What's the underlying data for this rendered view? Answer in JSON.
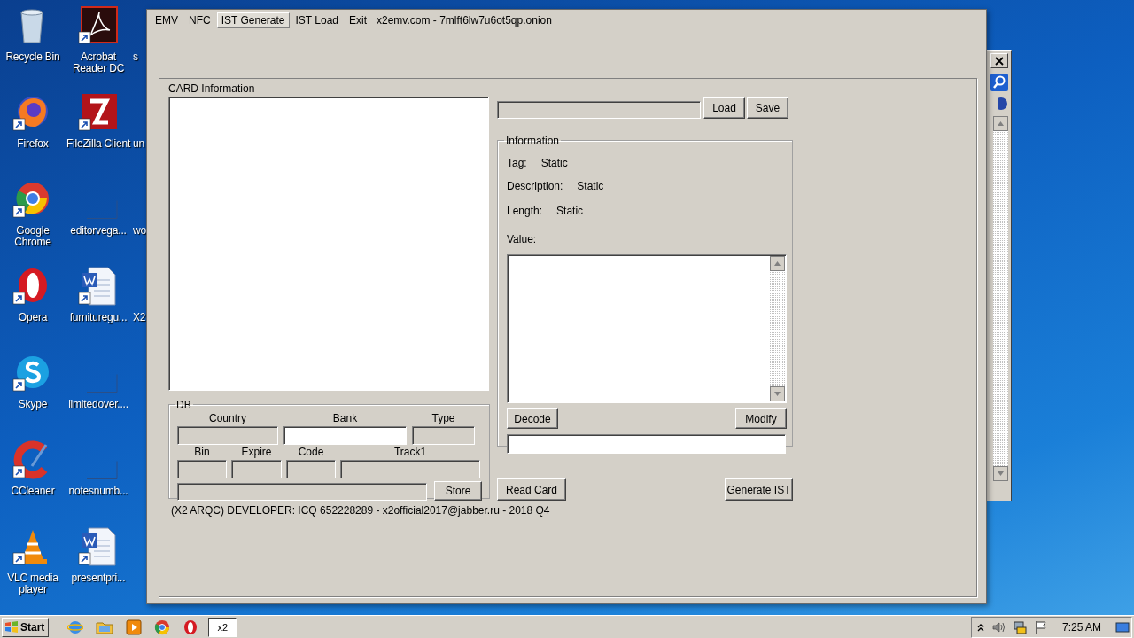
{
  "desktop_icons": [
    {
      "kind": "recycle",
      "label": "Recycle Bin"
    },
    {
      "kind": "firefox",
      "label": "Firefox"
    },
    {
      "kind": "chrome",
      "label": "Google Chrome"
    },
    {
      "kind": "opera",
      "label": "Opera"
    },
    {
      "kind": "skype",
      "label": "Skype"
    },
    {
      "kind": "ccleaner",
      "label": "CCleaner"
    },
    {
      "kind": "vlc",
      "label": "VLC media player"
    },
    {
      "kind": "pdf",
      "label": "Acrobat Reader DC"
    },
    {
      "kind": "filezilla",
      "label": "FileZilla Client"
    },
    {
      "kind": "blank",
      "label": "editorvega..."
    },
    {
      "kind": "word",
      "label": "furnituregu..."
    },
    {
      "kind": "blank",
      "label": "limitedover...."
    },
    {
      "kind": "blank",
      "label": "notesnumb..."
    },
    {
      "kind": "word",
      "label": "presentpri..."
    },
    {
      "kind": "covered",
      "label": "s"
    },
    {
      "kind": "covered",
      "label": "un"
    },
    {
      "kind": "covered",
      "label": "wo"
    },
    {
      "kind": "covered",
      "label": "X2"
    }
  ],
  "window": {
    "menu": [
      {
        "label": "EMV",
        "selected": false
      },
      {
        "label": "NFC",
        "selected": false
      },
      {
        "label": "IST Generate",
        "selected": true
      },
      {
        "label": "IST Load",
        "selected": false
      },
      {
        "label": "Exit",
        "selected": false
      }
    ],
    "title": "x2emv.com - 7mlft6lw7u6ot5qp.onion",
    "card_information": {
      "title": "CARD Information"
    },
    "db": {
      "title": "DB",
      "row1": [
        {
          "label": "Country",
          "disabled": true
        },
        {
          "label": "Bank",
          "disabled": false
        },
        {
          "label": "Type",
          "disabled": true
        }
      ],
      "row2": [
        {
          "label": "Bin",
          "disabled": true
        },
        {
          "label": "Expire",
          "disabled": true
        },
        {
          "label": "Code",
          "disabled": true
        },
        {
          "label": "Track1",
          "disabled": true
        }
      ],
      "extra_field": {
        "disabled": true
      },
      "store_button": "Store"
    },
    "footer": "(X2 ARQC) DEVELOPER: ICQ 652228289 - x2official2017@jabber.ru - 2018 Q4",
    "path_field": {
      "disabled": true
    },
    "file_buttons": [
      "Load",
      "Save"
    ],
    "information": {
      "title": "Information",
      "fields": [
        {
          "label": "Tag:",
          "value": "Static"
        },
        {
          "label": "Description:",
          "value": "Static"
        },
        {
          "label": "Length:",
          "value": "Static"
        }
      ],
      "value_label": "Value:",
      "decode_button": "Decode",
      "modify_button": "Modify"
    },
    "read_card_button": "Read Card",
    "generate_button": "Generate IST"
  },
  "taskbar": {
    "start": "Start",
    "apps": [
      {
        "kind": "ie",
        "selected": false
      },
      {
        "kind": "folder",
        "selected": false
      },
      {
        "kind": "media",
        "selected": false
      },
      {
        "kind": "chrome",
        "selected": false
      },
      {
        "kind": "opera",
        "selected": false
      },
      {
        "kind": "app",
        "label": "x2",
        "selected": true
      }
    ],
    "clock": "7:25 AM"
  }
}
